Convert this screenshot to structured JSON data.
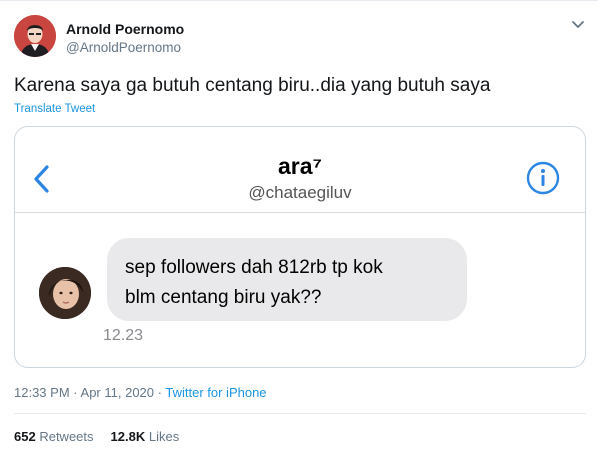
{
  "author": {
    "name": "Arnold Poernomo",
    "handle": "@ArnoldPoernomo"
  },
  "tweet": {
    "text": "Karena saya ga butuh centang biru..dia yang butuh saya",
    "translate_label": "Translate Tweet"
  },
  "embedded_chat": {
    "contact_name": "ara⁷",
    "contact_handle": "@chataegiluv",
    "message_line1": "sep followers dah 812rb tp kok",
    "message_line2": "blm centang biru yak??",
    "message_time": "12.23",
    "accent_color": "#2d86e4"
  },
  "meta": {
    "time": "12:33 PM",
    "separator": "·",
    "date": "Apr 11, 2020",
    "via": "Twitter for iPhone"
  },
  "stats": {
    "retweets_count": "652",
    "retweets_label": "Retweets",
    "likes_count": "12.8K",
    "likes_label": "Likes"
  },
  "icons": [
    "avatar",
    "chevron-down-icon",
    "back-chevron-icon",
    "info-icon",
    "chat-avatar"
  ]
}
